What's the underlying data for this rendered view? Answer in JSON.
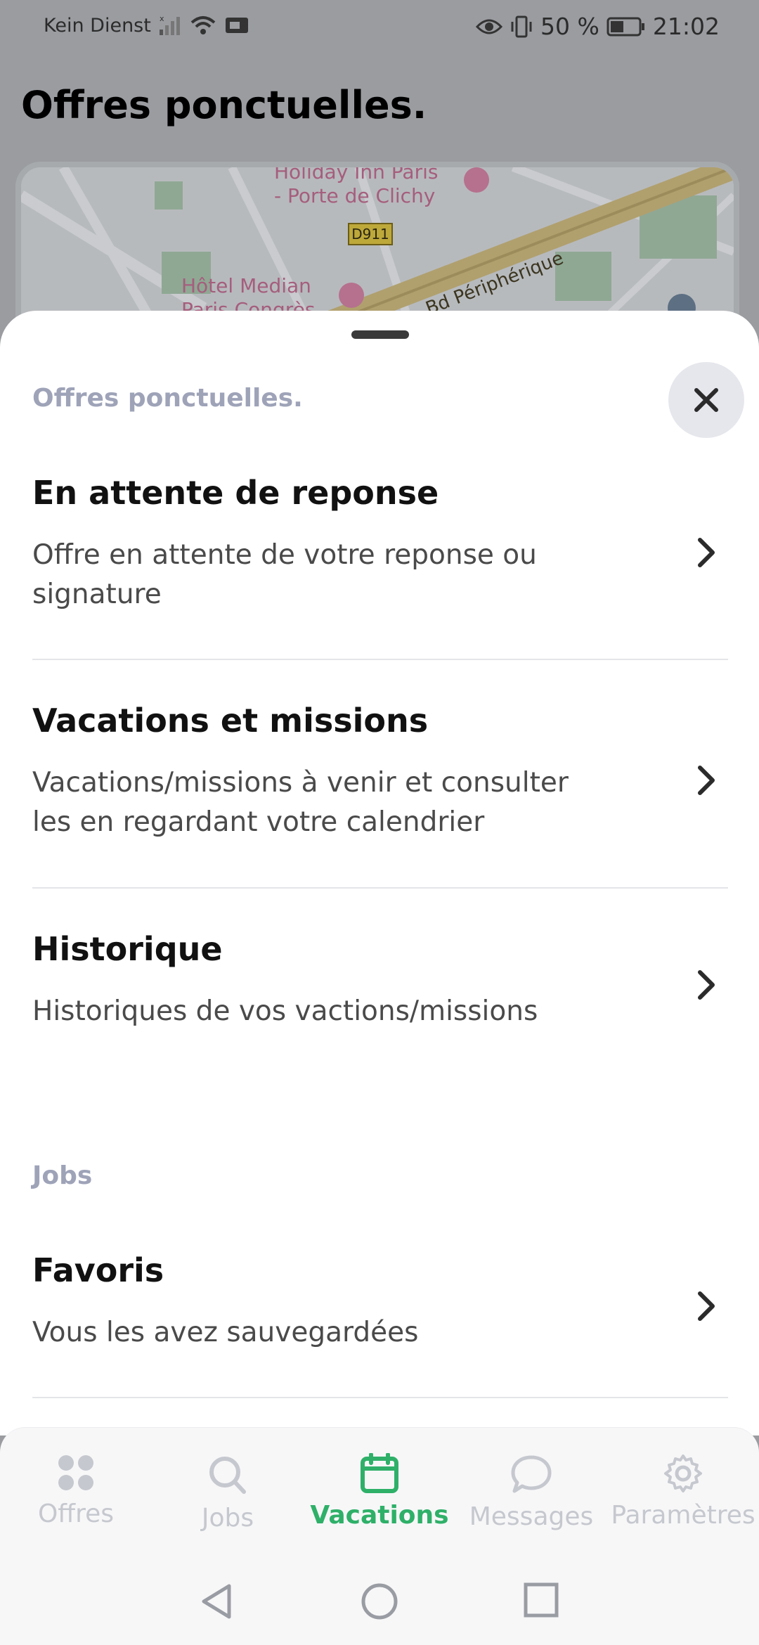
{
  "status_bar": {
    "carrier": "Kein Dienst",
    "battery": "50 %",
    "time": "21:02",
    "icons": [
      "no-signal-icon",
      "wifi-icon",
      "screencast-icon",
      "eye-icon",
      "vibrate-icon",
      "battery-icon"
    ]
  },
  "background": {
    "title": "Offres ponctuelles.",
    "map": {
      "labels": {
        "poi1_line1": "Holiday Inn Paris",
        "poi1_line2": "- Porte de Clichy",
        "road_badge": "D911",
        "poi2_line1": "Hôtel Median",
        "poi2_line2": "Paris Congrès",
        "boulevard": "Bd Périphérique"
      }
    }
  },
  "sheet": {
    "section1_title": "Offres ponctuelles.",
    "section2_title": "Jobs",
    "items": [
      {
        "title": "En attente de reponse",
        "subtitle": "Offre en attente de votre reponse ou signature"
      },
      {
        "title": "Vacations et missions",
        "subtitle": "Vacations/missions à venir et consulter les en regardant votre calendrier"
      },
      {
        "title": "Historique",
        "subtitle": "Historiques de vos vactions/missions"
      },
      {
        "title": "Favoris",
        "subtitle": "Vous les avez sauvegardées"
      }
    ]
  },
  "bottom_nav": {
    "items": [
      {
        "label": "Offres",
        "icon": "grid-icon",
        "active": false
      },
      {
        "label": "Jobs",
        "icon": "search-icon",
        "active": false
      },
      {
        "label": "Vacations",
        "icon": "calendar-icon",
        "active": true
      },
      {
        "label": "Messages",
        "icon": "chat-icon",
        "active": false
      },
      {
        "label": "Paramètres",
        "icon": "gear-icon",
        "active": false
      }
    ]
  },
  "colors": {
    "accent": "#2fb069",
    "section_title": "#9ea3b8",
    "inactive_nav": "#c6c8cf",
    "dim_background": "#9a9ca0"
  }
}
